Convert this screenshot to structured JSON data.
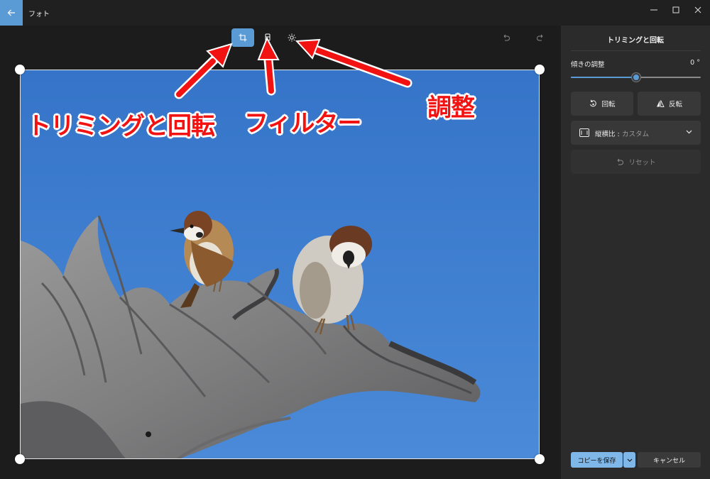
{
  "window": {
    "app_title": "フォト"
  },
  "toolbar": {
    "tools": [
      {
        "name": "crop-rotate",
        "icon": "crop-icon",
        "active": true
      },
      {
        "name": "filter",
        "icon": "filter-icon",
        "active": false
      },
      {
        "name": "adjust",
        "icon": "brightness-icon",
        "active": false
      }
    ]
  },
  "annotations": {
    "crop_label": "トリミングと回転",
    "filter_label": "フィルター",
    "adjust_label": "調整"
  },
  "panel": {
    "title": "トリミングと回転",
    "tilt_label": "傾きの調整",
    "tilt_value": "0 °",
    "tilt_position": 0.5,
    "rotate_label": "回転",
    "flip_label": "反転",
    "aspect_label": "縦横比 :",
    "aspect_value": "カスタム",
    "reset_label": "リセット",
    "save_copy_label": "コピーを保存",
    "cancel_label": "キャンセル"
  },
  "colors": {
    "accent": "#5b9bd5",
    "annotation": "#f21212",
    "sky": "#3f7fd0"
  }
}
